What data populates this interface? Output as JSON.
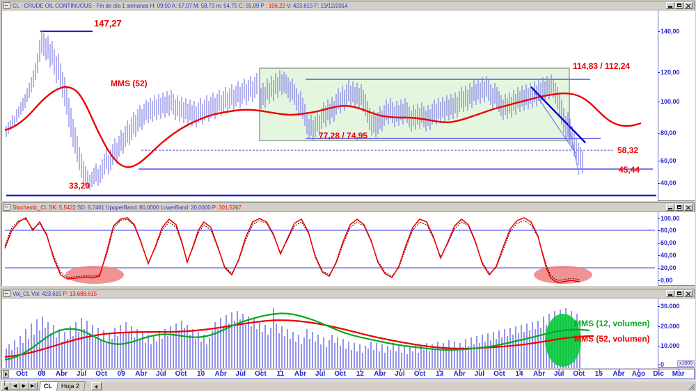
{
  "window": {
    "title": "CL - CRUDE OIL CONTINUOUS - Fin de día 1 semanas H: 09:00 A: 57,07 M: 58,73 m: 54,75 C: 55,09",
    "title_prefix": "CL - CRUDE OIL CONTINUOUS - Fin de día 1 semanas H: 09:00 A: 57,07 M: 58,73 m: 54,75 C: 55,09 ",
    "title_highlight": "P : 106,22",
    "title_suffix": " V: 423.615 F: 19/12/2014",
    "minimize_label": "Minimizar",
    "maximize_label": "Maximizar",
    "close_label": "Cerrar"
  },
  "price_panel": {
    "header": {
      "symbol": "CL - CRUDE OIL CONTINUOUS",
      "timeframe": "Fin de día 1 semanas",
      "hour": "H: 09:00",
      "open": "A: 57,07",
      "high": "M: 58,73",
      "low": "m: 54,75",
      "close": "C: 55,09",
      "prev": "P : 106,22",
      "volume": "V: 423.615",
      "date": "F: 19/12/2014"
    },
    "y_ticks": [
      "140,00",
      "120,00",
      "100,00",
      "80,00",
      "60,00",
      "40,00"
    ],
    "annotations": [
      {
        "name": "high-2008-label",
        "text": "147,27",
        "color": "#ee0000"
      },
      {
        "name": "mms52-label",
        "text": "MMS (52)",
        "color": "#ee0000"
      },
      {
        "name": "resistance-zone-label",
        "text": "114,83 / 112,24",
        "color": "#ee0000"
      },
      {
        "name": "support-zone-label",
        "text": "77,28 / 74,95",
        "color": "#ee0000"
      },
      {
        "name": "low-2008-label",
        "text": "33,20",
        "color": "#ee0000"
      },
      {
        "name": "target-1-label",
        "text": "58,32",
        "color": "#ee0000"
      },
      {
        "name": "target-2-label",
        "text": "45,44",
        "color": "#ee0000"
      }
    ]
  },
  "stochastic_panel": {
    "header_name": "Stochastic_CL",
    "header_sk": "SK: 5,5422",
    "header_sd": "SD: 6,7461",
    "header_upper": "UppperBand: 80,0000",
    "header_lower": "LowerBand: 20,0000",
    "header_p": "P: 301,5267",
    "y_ticks": [
      "100,00",
      "80,00",
      "60,00",
      "40,00",
      "20,00",
      "0,00"
    ]
  },
  "volume_panel": {
    "header_name": "Vol_CL",
    "header_vol": "Vol: 423.615",
    "header_p": "P: 13.688.615",
    "y_ticks": [
      "30.000",
      "20.000",
      "10.000",
      "0"
    ],
    "axis_multiplier": "x1000",
    "legend": [
      {
        "name": "mms12-volume-legend",
        "text": "MMS (12, volumen)",
        "color": "#00aa22"
      },
      {
        "name": "mms52-volume-legend",
        "text": "MMS (52, volumen)",
        "color": "#ee0000"
      }
    ]
  },
  "x_axis": {
    "labels": [
      "Oct",
      "08",
      "Abr",
      "Jul",
      "Oct",
      "09",
      "Abr",
      "Jul",
      "Oct",
      "10",
      "Abr",
      "Jul",
      "Oct",
      "11",
      "Abr",
      "Jul",
      "Oct",
      "12",
      "Abr",
      "Jul",
      "Oct",
      "13",
      "Abr",
      "Jul",
      "Oct",
      "14",
      "Abr",
      "Jul",
      "Oct",
      "15",
      "Abr",
      "Ago",
      "Dic",
      "Mar"
    ]
  },
  "sheet_tabs": {
    "first_label": "|◀",
    "prev_label": "◀",
    "next_label": "▶",
    "last_label": "▶|",
    "tabs": [
      {
        "label": "CL",
        "active": true
      },
      {
        "label": "Hoja 2",
        "active": false
      }
    ]
  },
  "chart_data": {
    "type": "line",
    "title": "CL - CRUDE OIL CONTINUOUS - Fin de día 1 semanas",
    "xlabel": "",
    "ylabel": "",
    "panels": [
      {
        "name": "price",
        "type": "line",
        "ylim": [
          30,
          150
        ],
        "y_ticks": [
          140,
          120,
          100,
          80,
          60,
          40
        ],
        "grid": false,
        "series": [
          {
            "name": "CL price (weekly HLC bars)",
            "color": "#7a7ae0"
          },
          {
            "name": "MMS (52)",
            "color": "#ee0000"
          }
        ],
        "levels": [
          {
            "name": "147,27 high",
            "value": 147.27,
            "color": "#2222cc"
          },
          {
            "name": "114,83 / 112,24 resistance",
            "value": 114.83,
            "color": "#7a7ae0"
          },
          {
            "name": "77,28 / 74,95 support",
            "value": 77.28,
            "color": "#7a7ae0"
          },
          {
            "name": "58,32 target",
            "value": 58.32,
            "color": "#2222cc"
          },
          {
            "name": "45,44 target",
            "value": 45.44,
            "color": "#7a7ae0"
          },
          {
            "name": "33,20 low",
            "value": 33.2,
            "color": "#2222cc"
          }
        ],
        "zone": {
          "name": "congestion box",
          "top": 114.83,
          "bottom": 74.95,
          "fill": "#e2f5dd"
        }
      },
      {
        "name": "stochastic",
        "type": "line",
        "ylim": [
          0,
          100
        ],
        "y_ticks": [
          100,
          80,
          60,
          40,
          20,
          0
        ],
        "bands": {
          "upper": 80,
          "lower": 20
        },
        "current_sk": 5.5422,
        "current_sd": 6.7461,
        "series": [
          {
            "name": "%K",
            "color": "#ee0000"
          },
          {
            "name": "%D",
            "color": "#330000"
          }
        ]
      },
      {
        "name": "volume",
        "type": "bar",
        "ylim": [
          0,
          32000
        ],
        "y_ticks": [
          30000,
          20000,
          10000,
          0
        ],
        "current_volume": 423615,
        "series": [
          {
            "name": "Volume",
            "color": "#8f8fe8"
          },
          {
            "name": "MMS (12, volumen)",
            "color": "#00aa22"
          },
          {
            "name": "MMS (52, volumen)",
            "color": "#ee0000"
          }
        ]
      }
    ],
    "x_categories": [
      "Oct",
      "08",
      "Abr",
      "Jul",
      "Oct",
      "09",
      "Abr",
      "Jul",
      "Oct",
      "10",
      "Abr",
      "Jul",
      "Oct",
      "11",
      "Abr",
      "Jul",
      "Oct",
      "12",
      "Abr",
      "Jul",
      "Oct",
      "13",
      "Abr",
      "Jul",
      "Oct",
      "14",
      "Abr",
      "Jul",
      "Oct",
      "15",
      "Abr",
      "Ago",
      "Dic",
      "Mar"
    ]
  }
}
